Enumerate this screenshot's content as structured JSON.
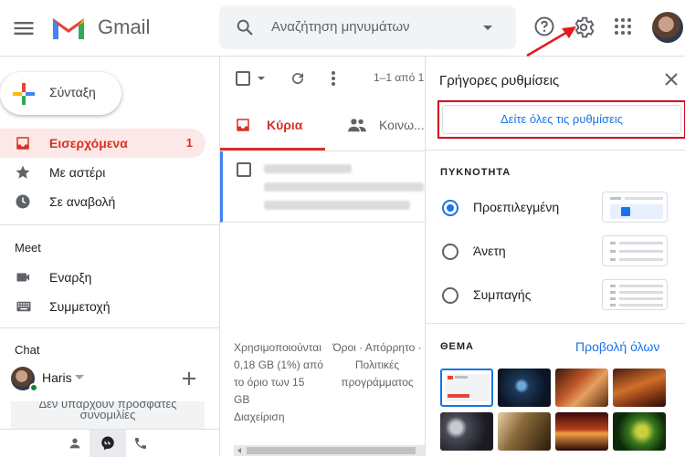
{
  "app": {
    "logo_text": "Gmail"
  },
  "search": {
    "placeholder": "Αναζήτηση μηνυμάτων"
  },
  "sidebar": {
    "compose_label": "Σύνταξη",
    "items": [
      {
        "label": "Εισερχόμενα",
        "count": "1",
        "icon": "inbox-icon",
        "active": true
      },
      {
        "label": "Με αστέρι",
        "count": "",
        "icon": "star-icon"
      },
      {
        "label": "Σε αναβολή",
        "count": "",
        "icon": "clock-icon"
      }
    ],
    "meet": {
      "title": "Meet",
      "items": [
        {
          "label": "Εναρξη",
          "icon": "video-camera-icon"
        },
        {
          "label": "Συμμετοχή",
          "icon": "keyboard-icon"
        }
      ]
    },
    "chat": {
      "title": "Chat",
      "user_name": "Haris",
      "empty_line1": "Δεν υπάρχουν πρόσφατες",
      "empty_line2": "συνομιλίες"
    }
  },
  "mail": {
    "page_range": "1–1 από 1",
    "tabs": [
      {
        "label": "Κύρια",
        "icon": "inbox-icon",
        "active": true
      },
      {
        "label": "Κοινω...",
        "icon": "people-icon"
      }
    ],
    "footer": {
      "storage_lines": [
        "Χρησιμοποιούνται",
        "0,18 GB (1%) από",
        "το όριο των 15",
        "GB",
        "Διαχείριση"
      ],
      "terms_lines": [
        "Όροι · Απόρρητο ·",
        "Πολιτικές",
        "προγράμματος"
      ]
    }
  },
  "quick_settings": {
    "title": "Γρήγορες ρυθμίσεις",
    "see_all_label": "Δείτε όλες τις ρυθμίσεις",
    "density": {
      "title": "ΠΥΚΝΟΤΗΤΑ",
      "options": [
        {
          "label": "Προεπιλεγμένη",
          "selected": true
        },
        {
          "label": "Άνετη",
          "selected": false
        },
        {
          "label": "Συμπαγής",
          "selected": false
        }
      ]
    },
    "theme": {
      "title": "ΘΕΜΑ",
      "view_all_label": "Προβολή όλων"
    }
  },
  "colors": {
    "accent_red": "#d93025",
    "link_blue": "#1a73e8",
    "highlight_box": "#d0021b"
  }
}
